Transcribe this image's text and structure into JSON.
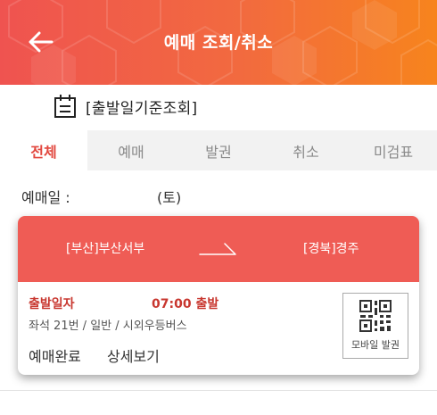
{
  "header": {
    "title": "예매 조회/취소",
    "back_icon": "arrow-left-icon",
    "gradient_start": "#ef5350",
    "gradient_end": "#f7841d"
  },
  "search": {
    "label": "[출발일기준조회]",
    "icon": "calendar-icon"
  },
  "tabs": [
    {
      "label": "전체",
      "active": true
    },
    {
      "label": "예매",
      "active": false
    },
    {
      "label": "발권",
      "active": false
    },
    {
      "label": "취소",
      "active": false
    },
    {
      "label": "미검표",
      "active": false
    }
  ],
  "reservation_date": {
    "label": "예매일 :",
    "day": "(토)"
  },
  "ticket": {
    "from": "[부산]부산서부",
    "to": "[경북]경주",
    "departure_label": "출발일자",
    "departure_time": "07:00 출발",
    "seat_info": "좌석 21번 / 일반 / 시외우등버스",
    "status": "예매완료",
    "detail_link": "상세보기",
    "mobile_ticket_label": "모바일 발권",
    "accent_color": "#ef5c55",
    "highlight_color": "#c8372f"
  }
}
